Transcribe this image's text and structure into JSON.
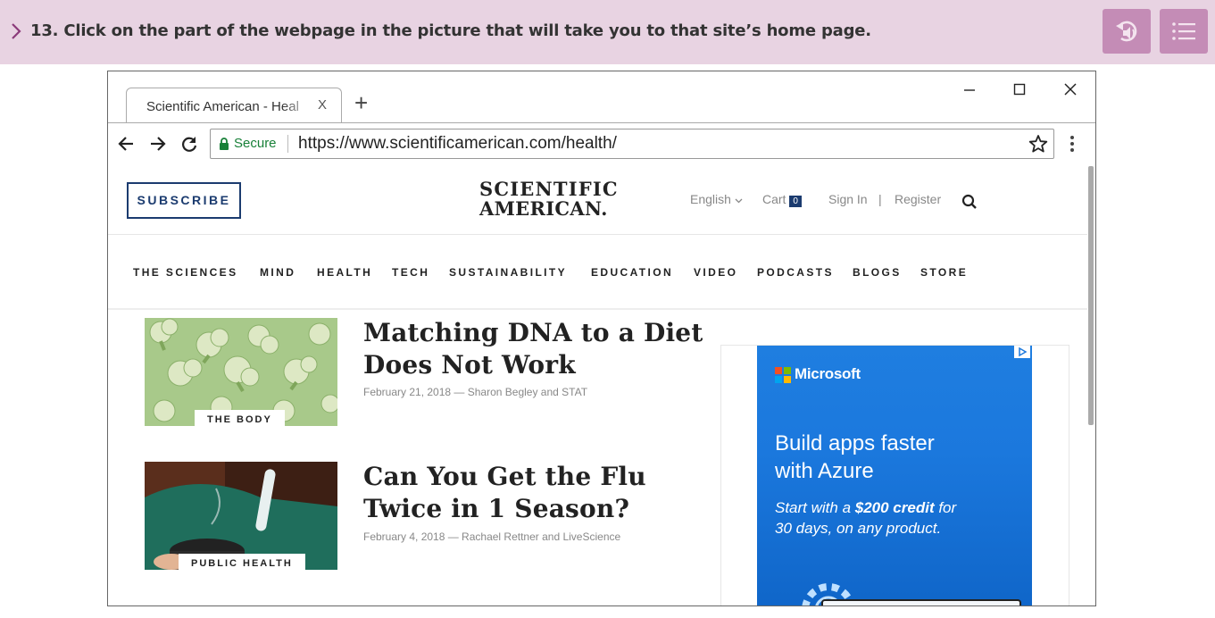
{
  "question": {
    "text": "13. Click on the part of the webpage in the picture that will take you to that site’s home page.",
    "audio_icon": "audio-replay-icon",
    "menu_icon": "list-menu-icon"
  },
  "browser": {
    "tab_title": "Scientific American - Heal",
    "tab_close": "X",
    "new_tab": "+",
    "secure_label": "Secure",
    "url": "https://www.scientificamerican.com/health/"
  },
  "site": {
    "subscribe_label": "SUBSCRIBE",
    "logo_line1": "SCIENTIFIC",
    "logo_line2": "AMERICAN.",
    "language": "English",
    "cart_label": "Cart",
    "cart_count": "0",
    "sign_in": "Sign In",
    "separator": "|",
    "register": "Register",
    "nav": [
      "THE SCIENCES",
      "MIND",
      "HEALTH",
      "TECH",
      "SUSTAINABILITY",
      "EDUCATION",
      "VIDEO",
      "PODCASTS",
      "BLOGS",
      "STORE"
    ],
    "articles": [
      {
        "category": "THE BODY",
        "title_line1": "Matching DNA to a Diet",
        "title_line2": "Does Not Work",
        "meta": "February 21, 2018 — Sharon Begley and STAT"
      },
      {
        "category": "PUBLIC HEALTH",
        "title_line1": "Can You Get the Flu",
        "title_line2": "Twice in 1 Season?",
        "meta": "February 4, 2018 — Rachael Rettner and LiveScience"
      }
    ],
    "ad": {
      "brand": "Microsoft",
      "headline_line1": "Build apps faster",
      "headline_line2": "with Azure",
      "sub_prefix": "Start with a ",
      "sub_bold": "$200 credit",
      "sub_suffix": " for",
      "sub_line2": "30 days, on any product."
    }
  },
  "colors": {
    "question_bar": "#e8d3e2",
    "question_button": "#c48cb6",
    "accent_chevron": "#8b3a7a",
    "brand_navy": "#1b3b6f",
    "secure_green": "#188038",
    "ad_blue": "#1b78dd"
  }
}
